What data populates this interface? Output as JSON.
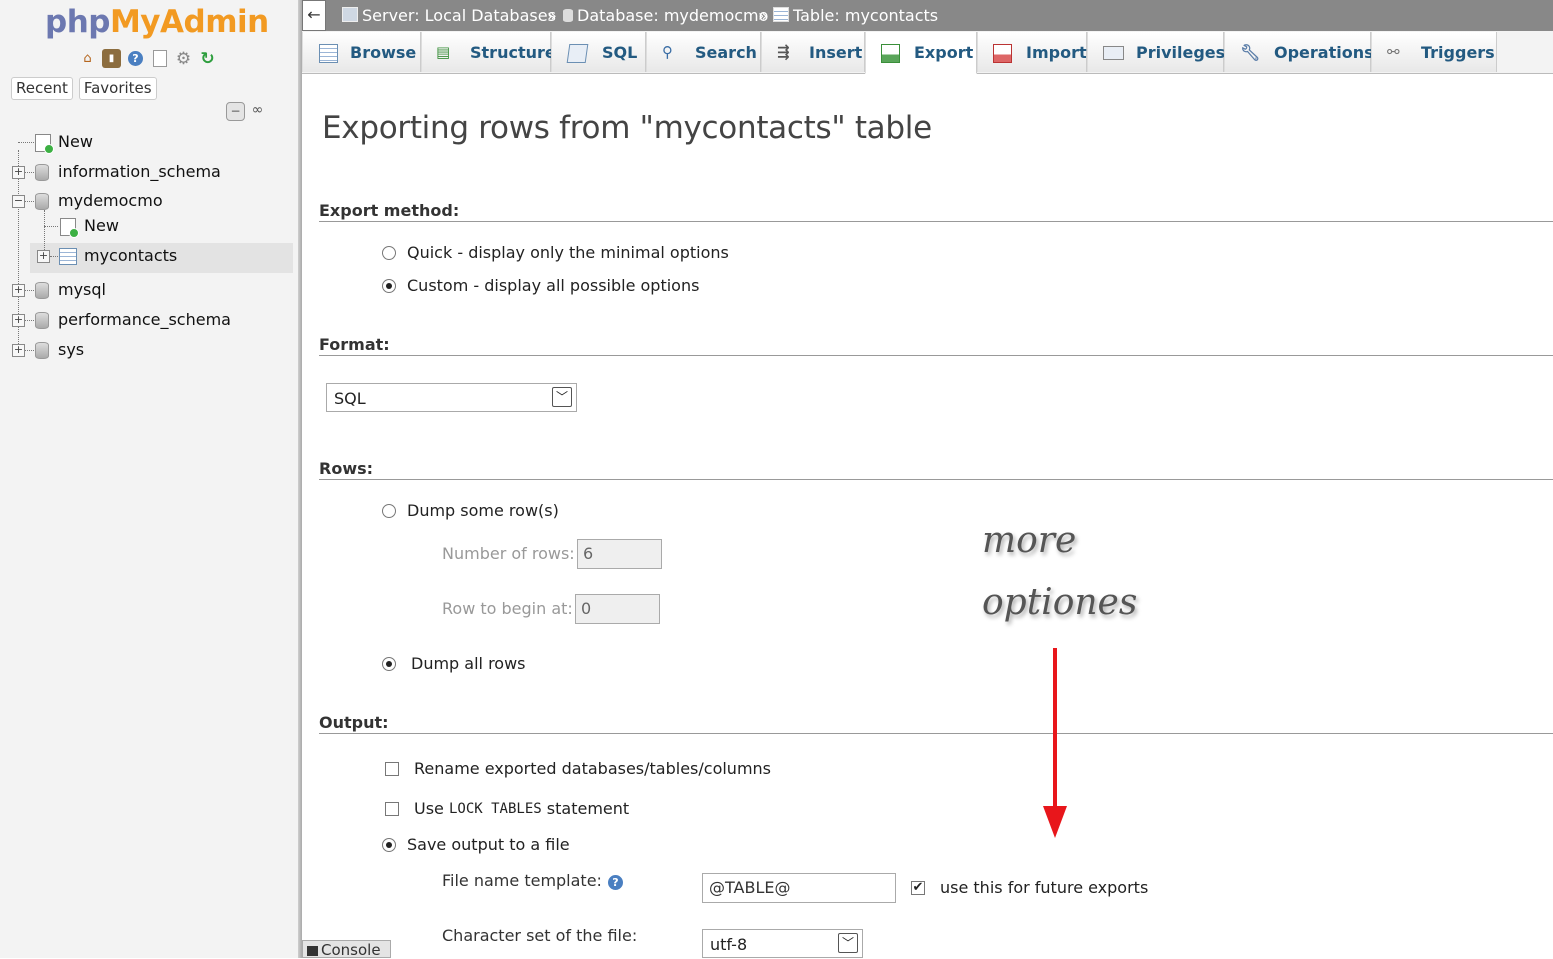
{
  "sidebar": {
    "logo": {
      "part1": "php",
      "part2": "My",
      "part3": "Admin"
    },
    "logo_icons": [
      "home-icon",
      "exit-icon",
      "help-icon",
      "docs-icon",
      "settings-icon",
      "reload-icon"
    ],
    "recent_label": "Recent",
    "favorites_label": "Favorites",
    "tree": {
      "new_root": "New",
      "db1": "information_schema",
      "db2": "mydemocmo",
      "db2_new": "New",
      "db2_table": "mycontacts",
      "db3": "mysql",
      "db4": "performance_schema",
      "db5": "sys"
    }
  },
  "breadcrumb": {
    "back": "←",
    "server": "Server: Local Databases",
    "sep1": "»",
    "database": "Database: mydemocmo",
    "sep2": "»",
    "table": "Table: mycontacts"
  },
  "tabs": {
    "browse": "Browse",
    "structure": "Structure",
    "sql": "SQL",
    "search": "Search",
    "insert": "Insert",
    "export": "Export",
    "import": "Import",
    "privileges": "Privileges",
    "operations": "Operations",
    "triggers": "Triggers"
  },
  "main": {
    "title": "Exporting rows from \"mycontacts\" table",
    "export_method": {
      "heading": "Export method:",
      "quick": "Quick - display only the minimal options",
      "custom": "Custom - display all possible options",
      "selected": "custom"
    },
    "format": {
      "heading": "Format:",
      "selected": "SQL"
    },
    "rows": {
      "heading": "Rows:",
      "dump_some": "Dump some row(s)",
      "number_of_rows_label": "Number of rows:",
      "number_of_rows_value": "6",
      "row_begin_label": "Row to begin at:",
      "row_begin_value": "0",
      "dump_all": "Dump all rows",
      "selected": "dump_all"
    },
    "output": {
      "heading": "Output:",
      "rename": "Rename exported databases/tables/columns",
      "lock_pre": "Use",
      "lock_code": "LOCK TABLES",
      "lock_post": "statement",
      "save_to_file": "Save output to a file",
      "file_name_template_label": "File name template:",
      "file_name_template_value": "@TABLE@",
      "use_for_future": "use this for future exports",
      "charset_label": "Character set of the file:",
      "charset_value": "utf-8"
    },
    "annotation_line1": "more",
    "annotation_line2": "optiones"
  },
  "console": {
    "label": "Console"
  },
  "colors": {
    "tab_text": "#235a81",
    "crumb_bar": "#888888",
    "annotation_arrow": "#e8161b",
    "logo_blue": "#6c78b0",
    "logo_orange": "#f29a22"
  }
}
